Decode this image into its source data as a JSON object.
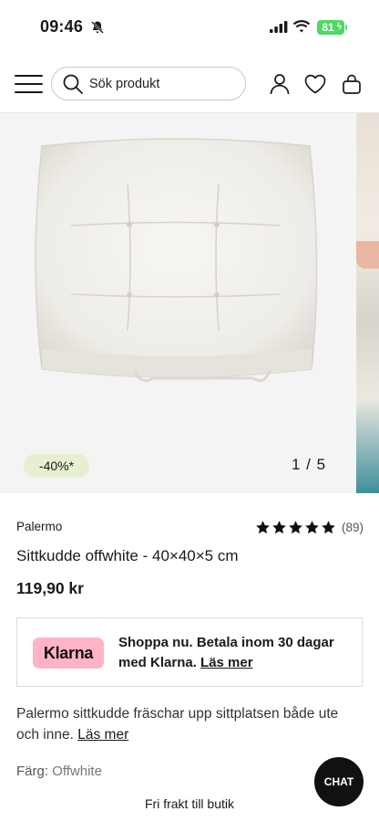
{
  "status_bar": {
    "time": "09:46",
    "battery": "81"
  },
  "header": {
    "search": {
      "placeholder": "Sök produkt"
    },
    "icons": [
      "menu-icon",
      "search-icon",
      "user-icon",
      "heart-icon",
      "bag-icon"
    ]
  },
  "gallery": {
    "discount_badge": "-40%*",
    "page_counter": "1 / 5"
  },
  "product": {
    "brand": "Palermo",
    "rating": 5,
    "review_count": "(89)",
    "title": "Sittkudde offwhite - 40×40×5 cm",
    "price": "119,90 kr"
  },
  "klarna": {
    "logo_text": "Klarna",
    "text": "Shoppa nu. Betala inom 30 dagar med Klarna.",
    "link": "Läs mer",
    "logo_color": "#ffb3c7"
  },
  "description": {
    "text": "Palermo sittkudde fräschar upp sittplatsen både ute och inne.",
    "link": "Läs mer"
  },
  "color": {
    "label": "Färg:",
    "value": "Offwhite"
  },
  "shipping_banner": "Fri frakt till butik",
  "chat_button": "CHAT",
  "colors": {
    "badge_bg": "#e6efcf",
    "battery_green": "#4cd964",
    "chat_bg": "#111111"
  }
}
